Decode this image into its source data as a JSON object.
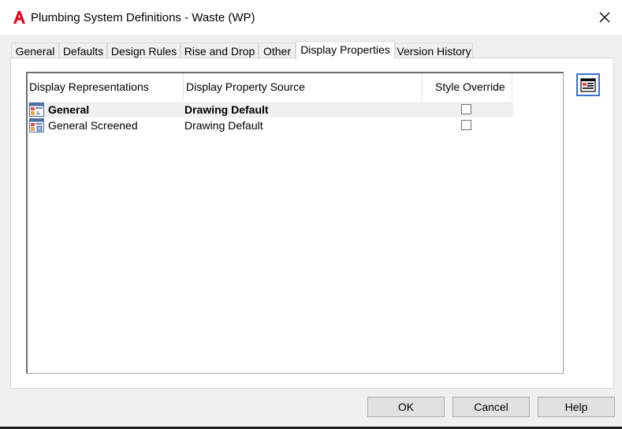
{
  "window": {
    "title": "Plumbing System Definitions - Waste (WP)",
    "accent_color": "#e8001c"
  },
  "tabs": [
    {
      "label": "General"
    },
    {
      "label": "Defaults"
    },
    {
      "label": "Design Rules"
    },
    {
      "label": "Rise and Drop"
    },
    {
      "label": "Other"
    },
    {
      "label": "Display Properties",
      "active": true
    },
    {
      "label": "Version History"
    }
  ],
  "table": {
    "columns": [
      "Display Representations",
      "Display Property Source",
      "Style Override"
    ],
    "rows": [
      {
        "representation": "General",
        "source": "Drawing Default",
        "style_override": false,
        "selected": true,
        "icon": "display-rep-general-icon"
      },
      {
        "representation": "General Screened",
        "source": "Drawing Default",
        "style_override": false,
        "selected": false,
        "icon": "display-rep-screened-icon"
      }
    ]
  },
  "side_button": {
    "icon": "edit-display-properties-icon"
  },
  "buttons": {
    "ok": "OK",
    "cancel": "Cancel",
    "help": "Help"
  }
}
